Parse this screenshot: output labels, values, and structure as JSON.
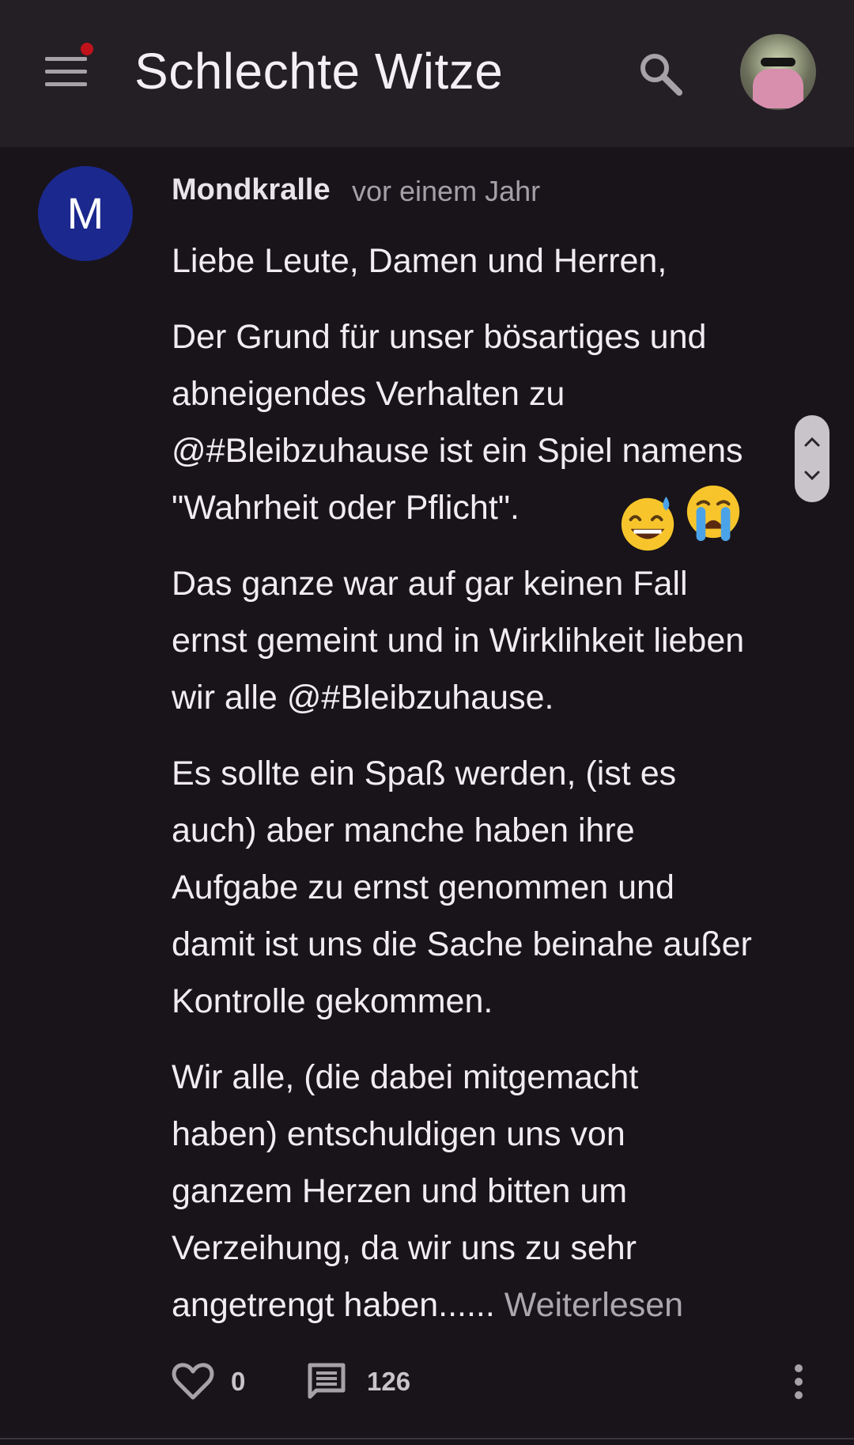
{
  "header": {
    "title": "Schlechte Witze",
    "menu_icon": "hamburger-menu-icon",
    "notification_dot_color": "#c0121b",
    "search_icon": "search-icon",
    "profile_avatar": "profile-avatar-image"
  },
  "comment": {
    "avatar_letter": "M",
    "avatar_color": "#1b288e",
    "author": "Mondkralle",
    "timestamp": "vor einem Jahr",
    "lines": [
      "Liebe Leute, Damen und Herren,",
      "Der Grund für unser bösartiges und",
      "abneigendes Verhalten zu",
      "@#Bleibzuhause ist ein Spiel namens",
      "\"Wahrheit oder Pflicht\".",
      "Das ganze war auf gar keinen Fall",
      "ernst gemeint und in Wirklihkeit lieben",
      "wir alle @#Bleibzuhause.",
      "Es sollte ein Spaß werden, (ist es",
      "auch) aber manche haben ihre",
      "Aufgabe zu ernst genommen und",
      "damit ist uns die Sache beinahe außer",
      "Kontrolle gekommen.",
      "Wir alle, (die dabei mitgemacht",
      "haben) entschuldigen uns von",
      "ganzem Herzen und bitten um",
      "Verzeihung, da wir uns zu sehr",
      "angetrengt haben......"
    ],
    "read_more": "Weiterlesen",
    "emojis": [
      "grinning-face-with-sweat-emoji",
      "loudly-crying-face-emoji"
    ]
  },
  "footer": {
    "like_icon": "heart-icon",
    "like_count": "0",
    "reply_icon": "comment-icon",
    "reply_count": "126",
    "more_icon": "more-vertical-icon"
  },
  "scroll": {
    "up_icon": "chevron-up-icon",
    "down_icon": "chevron-down-icon"
  }
}
